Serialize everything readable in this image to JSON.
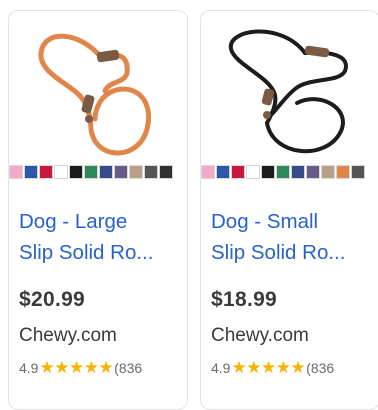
{
  "products": [
    {
      "title_line1": "Dog - Large",
      "title_line2": "Slip Solid Ro...",
      "price": "$20.99",
      "merchant": "Chewy.com",
      "rating": "4.9",
      "stars": "★★★★★",
      "review_count": "(836",
      "rating_value": 4.9,
      "leash_color": "#e0864a",
      "swatches": [
        "#f2a9c8",
        "#2b57a6",
        "#c8193d",
        "#ffffff",
        "#1a1a1a",
        "#2f8a5a",
        "#3a4a8a",
        "#6a5a8a",
        "#b8a088",
        "#555555",
        "#303030"
      ]
    },
    {
      "title_line1": "Dog - Small",
      "title_line2": "Slip Solid Ro...",
      "price": "$18.99",
      "merchant": "Chewy.com",
      "rating": "4.9",
      "stars": "★★★★★",
      "review_count": "(836",
      "rating_value": 4.9,
      "leash_color": "#1c1c1c",
      "swatches": [
        "#f2a9c8",
        "#2b57a6",
        "#c8193d",
        "#ffffff",
        "#1a1a1a",
        "#2f8a5a",
        "#3a4a8a",
        "#6a5a8a",
        "#b8a088",
        "#e0864a",
        "#555555"
      ]
    }
  ]
}
